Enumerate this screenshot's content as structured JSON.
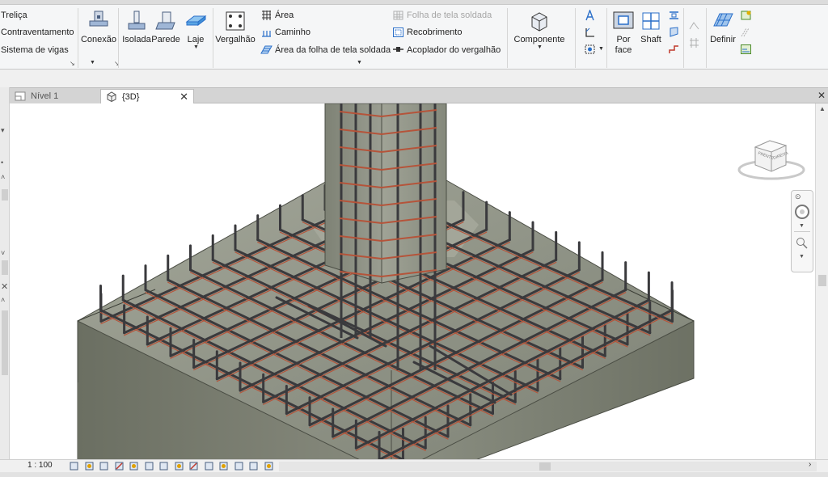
{
  "ribbon": {
    "structure_panel": {
      "items": [
        "Treliça",
        "Contraventamento",
        "Sistema de vigas"
      ]
    },
    "connection": {
      "label": "Conexão"
    },
    "foundation": {
      "isolated_label": "Isolada",
      "wall_label": "Parede",
      "slab_label": "Laje"
    },
    "reinforcement": {
      "rebar_label": "Vergalhão",
      "area_label": "Área",
      "path_label": "Caminho",
      "fabric_area_label": "Área da folha de tela soldada",
      "fabric_sheet_label": "Folha de tela soldada",
      "cover_label": "Recobrimento",
      "coupler_label": "Acoplador do vergalhão"
    },
    "model": {
      "component_label": "Componente"
    },
    "opening": {
      "by_face_label": "Por face",
      "shaft_label": "Shaft"
    },
    "datum": {
      "set_label": "Definir"
    }
  },
  "tabs": [
    {
      "label": "Nível 1",
      "icon": "floor-plan-icon",
      "active": false
    },
    {
      "label": "{3D}",
      "icon": "3d-view-icon",
      "active": true
    }
  ],
  "viewcube": {
    "front_label": "FRENTE",
    "right_label": "DIREITA"
  },
  "statusbar": {
    "scale": "1 : 100"
  },
  "colors": {
    "concrete": "#8c8f83",
    "rebar": "#3a3a3d",
    "rebar_red": "#b5543a",
    "ribbon_bg": "#f5f6f7",
    "accent_blue": "#2a6fc9"
  }
}
